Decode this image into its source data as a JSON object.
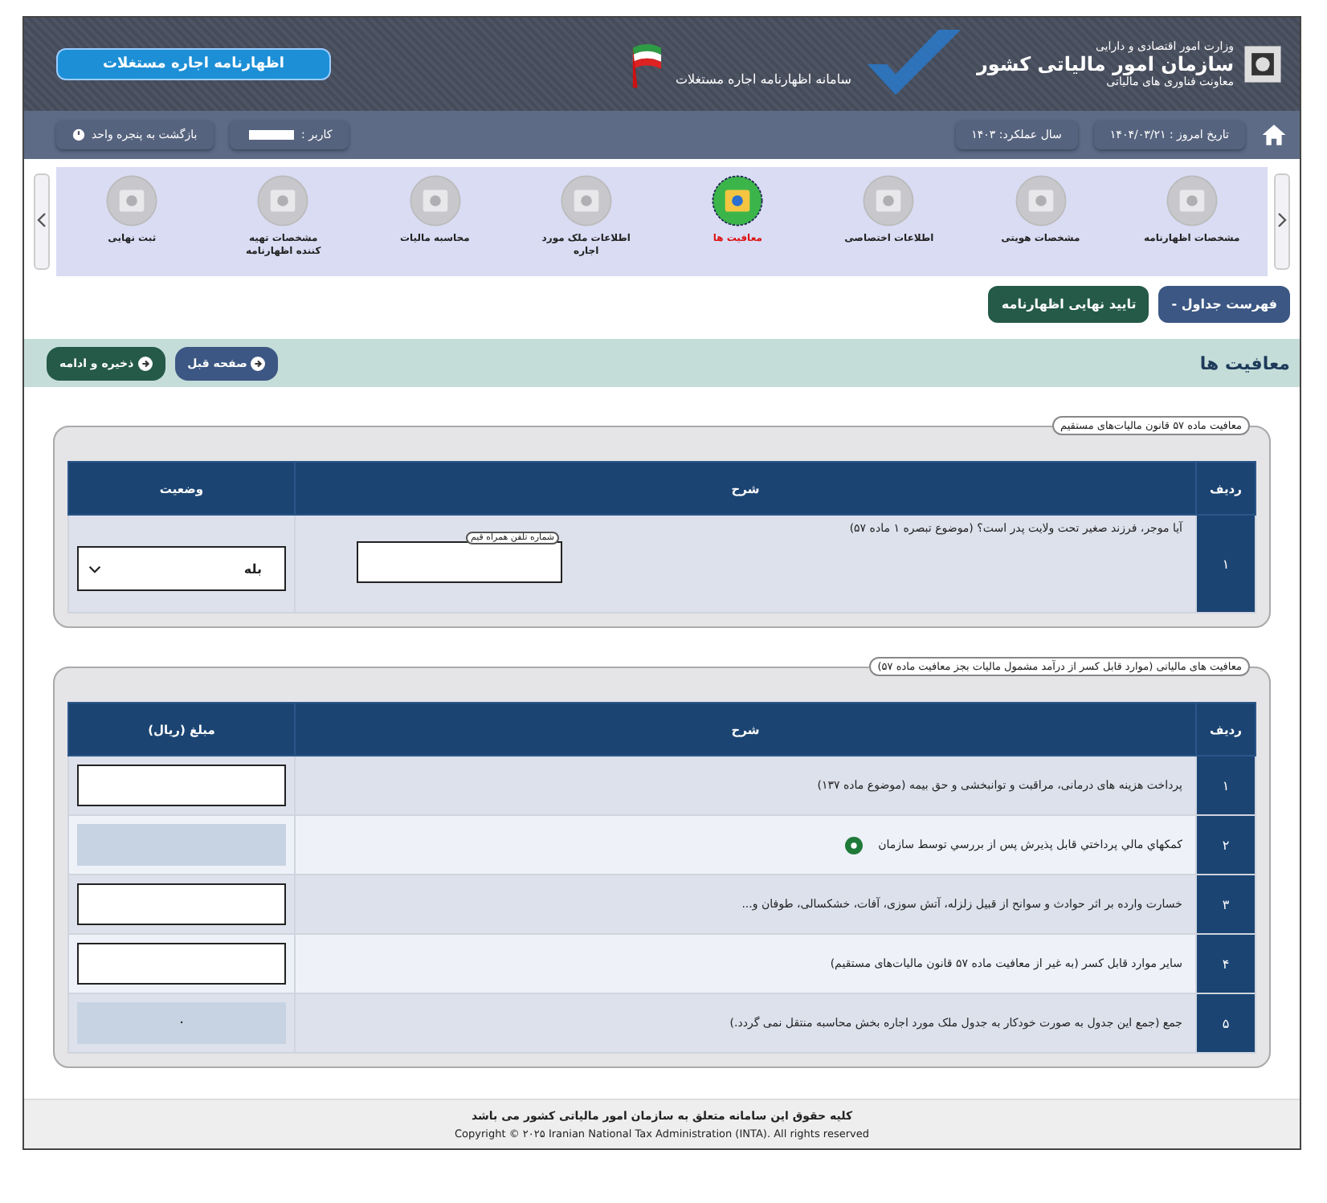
{
  "header": {
    "ministry": "وزارت امور اقتصادی و دارایی",
    "org": "سازمان امور مالیاتی کشور",
    "deputy": "معاونت فناوری های مالیاتی",
    "system": "سامانه اظهارنامه اجاره مستغلات",
    "badge": "اظهارنامه اجاره مستغلات"
  },
  "nav": {
    "date": "تاریخ امروز : ۱۴۰۴/۰۳/۲۱",
    "year": "سال عملکرد: ۱۴۰۳",
    "user": "کاربر :",
    "back": "بازگشت به پنجره واحد"
  },
  "steps": [
    {
      "label": "مشخصات اظهارنامه",
      "selected": false
    },
    {
      "label": "مشخصات هویتی",
      "selected": false
    },
    {
      "label": "اطلاعات اختصاصی",
      "selected": false
    },
    {
      "label": "معافیت ها",
      "selected": true
    },
    {
      "label": "اطلاعات ملک مورد اجاره",
      "selected": false
    },
    {
      "label": "محاسبه مالیات",
      "selected": false
    },
    {
      "label": "مشخصات تهیه کننده اظهارنامه",
      "selected": false
    },
    {
      "label": "ثبت نهایی",
      "selected": false
    }
  ],
  "actions": {
    "tables": "فهرست جداول -",
    "confirm": "تایید نهایی اظهارنامه"
  },
  "section": {
    "title": "معافیت ها",
    "prev": "صفحه قبل",
    "save": "ذخیره و ادامه"
  },
  "table1": {
    "legend": "معافیت ماده ۵۷ قانون مالیات‌های مستقیم",
    "columns": [
      "ردیف",
      "شرح",
      "وضعیت"
    ],
    "rows": [
      {
        "index": "۱",
        "text": "آیا موجر، فرزند صغیر تحت ولایت پدر است؟ (موضوع تبصره ۱ ماده ۵۷)",
        "phone_label": "شماره تلفن همراه قیم",
        "status": "بله"
      }
    ]
  },
  "table2": {
    "legend": "معافیت های مالیاتی (موارد قابل کسر از درآمد مشمول مالیات بجز معافیت ماده ۵۷)",
    "columns": [
      "ردیف",
      "شرح",
      "مبلغ (ریال)"
    ],
    "rows": [
      {
        "index": "۱",
        "text": "پرداخت هزینه های درمانی، مراقبت و توانبخشی و حق بیمه (موضوع ماده ۱۳۷)",
        "disabled": false,
        "info": false
      },
      {
        "index": "۲",
        "text": "کمکهاي مالي پرداختي قابل پذيرش پس از بررسي توسط سازمان",
        "disabled": true,
        "info": true
      },
      {
        "index": "۳",
        "text": "خسارت وارده بر اثر حوادث و سوانح از قبیل زلزله، آتش سوزی، آفات، خشکسالی، طوفان و...",
        "disabled": false,
        "info": false
      },
      {
        "index": "۴",
        "text": "سایر موارد قابل کسر (به غیر از معافیت ماده ۵۷ قانون مالیات‌های مستقیم)",
        "disabled": false,
        "info": false
      },
      {
        "index": "۵",
        "text": "جمع (جمع این جدول به صورت خودکار به جدول ملک مورد اجاره بخش محاسبه منتقل نمی گردد.)",
        "disabled": true,
        "info": false,
        "value": "۰"
      }
    ]
  },
  "footer": {
    "rights": "کلیه حقوق این سامانه متعلق به سازمان امور مالیاتی کشور می باشد",
    "copyright": "Copyright © ۲۰۲۵ Iranian National Tax Administration (INTA). All rights reserved"
  }
}
